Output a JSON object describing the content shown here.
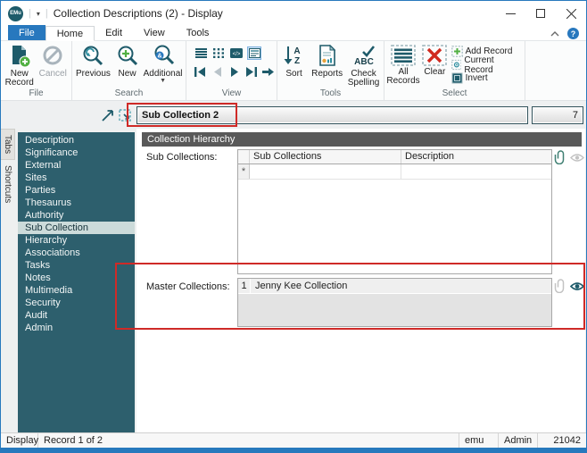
{
  "window": {
    "logo_text": "EMu",
    "title": "Collection Descriptions (2) - Display"
  },
  "ribbon": {
    "tabs": {
      "file": "File",
      "home": "Home",
      "edit": "Edit",
      "view": "View",
      "tools": "Tools"
    },
    "groups": {
      "file": {
        "label": "File",
        "new_record": "New\nRecord",
        "cancel": "Cancel"
      },
      "search": {
        "label": "Search",
        "previous": "Previous",
        "new": "New",
        "additional": "Additional"
      },
      "view": {
        "label": "View"
      },
      "tools": {
        "label": "Tools",
        "sort": "Sort",
        "reports": "Reports",
        "check_spelling": "Check\nSpelling"
      },
      "select": {
        "label": "Select",
        "all_records": "All\nRecords",
        "clear": "Clear",
        "add_record": "Add Record",
        "current_record": "Current Record",
        "invert": "Invert"
      }
    }
  },
  "record_bar": {
    "summary": "Sub Collection 2",
    "count": "7"
  },
  "side_tabs": {
    "tabs": "Tabs",
    "shortcuts": "Shortcuts"
  },
  "sidebar": {
    "selected": "Sub Collection",
    "items": [
      "Description",
      "Significance",
      "External",
      "Sites",
      "Parties",
      "Thesaurus",
      "Authority",
      "Sub Collection",
      "Hierarchy",
      "Associations",
      "Tasks",
      "Notes",
      "Multimedia",
      "Security",
      "Audit",
      "Admin"
    ]
  },
  "main": {
    "section_title": "Collection Hierarchy",
    "sub_collections": {
      "label": "Sub Collections:",
      "columns": [
        "Sub Collections",
        "Description"
      ],
      "new_row_marker": "*"
    },
    "master_collections": {
      "label": "Master Collections:",
      "rows": [
        {
          "num": "1",
          "value": "Jenny Kee Collection"
        }
      ]
    }
  },
  "status": {
    "mode": "Display",
    "record_info": "Record 1 of 2",
    "server": "emu",
    "user": "Admin",
    "code": "21042"
  },
  "colors": {
    "accent_blue": "#2878be",
    "teal": "#1e5b6a",
    "sidebar_teal": "#2d5f6d",
    "highlight_red": "#cf2a27",
    "green": "#4caf50",
    "clear_red": "#d02b20",
    "section_gray": "#595959"
  }
}
